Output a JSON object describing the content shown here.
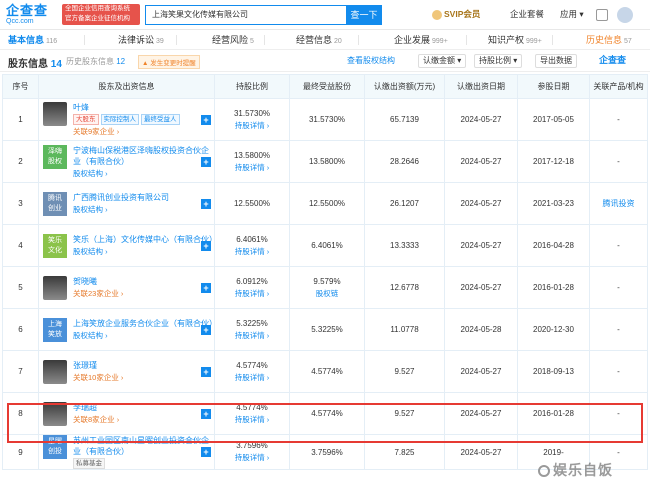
{
  "header": {
    "logo_main": "企查查",
    "logo_sub": "Qcc.com",
    "badge": "全国企业信用查询系统 官方备案企业征信机构",
    "search_value": "上海笑果文化传媒有限公司",
    "search_btn": "查一下",
    "svip": "SVIP会员",
    "enterprise": "企业套餐",
    "apps": "应用 ▾"
  },
  "tabs": [
    {
      "label": "基本信息",
      "count": "116"
    },
    {
      "label": "法律诉讼",
      "count": "39"
    },
    {
      "label": "经营风险",
      "count": "5"
    },
    {
      "label": "经营信息",
      "count": "20"
    },
    {
      "label": "企业发展",
      "count": "999+"
    },
    {
      "label": "知识产权",
      "count": "999+"
    },
    {
      "label": "历史信息",
      "count": "57"
    }
  ],
  "subbar": {
    "title": "股东信息",
    "count": "14",
    "history": "历史股东信息",
    "history_count": "12",
    "warn": "▲ 发生变更时提醒",
    "view_map": "查看股权结构",
    "btn_amount": "认缴金额 ▾",
    "btn_ratio": "持股比例 ▾",
    "btn_export": "导出数据",
    "brand": "企查查"
  },
  "columns": [
    "序号",
    "股东及出资信息",
    "持股比例",
    "最终受益股份",
    "认缴出资额(万元)",
    "认缴出资日期",
    "参股日期",
    "关联产品/机构"
  ],
  "rows": [
    {
      "no": "1",
      "name": "叶烽",
      "avatar": "photo",
      "tags": [
        [
          "大股东",
          "red"
        ],
        [
          "实际控制人",
          "blue"
        ],
        [
          "最终受益人",
          "blue"
        ]
      ],
      "link": "关联9家企业 ›",
      "link_color": "orange",
      "ratio": "31.5730%",
      "ratio_link": "持股详情 ›",
      "final": "31.5730%",
      "amount": "65.7139",
      "sub_date": "2024-05-27",
      "join_date": "2017-05-05",
      "product": "-"
    },
    {
      "no": "2",
      "name": "宁波梅山保税港区泽嗨股权投资合伙企业（有限合伙）",
      "avatar": "logo",
      "logo_text": "泽嗨股权",
      "logo_color": "#5cb85c",
      "tags": [],
      "link": "股权结构 ›",
      "link_color": "blue",
      "ratio": "13.5800%",
      "ratio_link": "持股详情 ›",
      "final": "13.5800%",
      "amount": "28.2646",
      "sub_date": "2024-05-27",
      "join_date": "2017-12-18",
      "product": "-"
    },
    {
      "no": "3",
      "name": "广西腾讯创业投资有限公司",
      "avatar": "logo",
      "logo_text": "腾讯创业",
      "logo_color": "#6f8fb4",
      "tags": [],
      "link": "股权结构 ›",
      "link_color": "blue",
      "ratio": "12.5500%",
      "ratio_link": "",
      "final": "12.5500%",
      "amount": "26.1207",
      "sub_date": "2024-05-27",
      "join_date": "2021-03-23",
      "product": "腾讯投资"
    },
    {
      "no": "4",
      "name": "笑乐（上海）文化传媒中心（有限合伙）",
      "avatar": "logo",
      "logo_text": "笑乐文化",
      "logo_color": "#8bc34a",
      "tags": [],
      "link": "股权结构 ›",
      "link_color": "blue",
      "ratio": "6.4061%",
      "ratio_link": "持股详情 ›",
      "final": "6.4061%",
      "amount": "13.3333",
      "sub_date": "2024-05-27",
      "join_date": "2016-04-28",
      "product": "-"
    },
    {
      "no": "5",
      "name": "贺晓曦",
      "avatar": "photo",
      "tags": [],
      "link": "关联23家企业 ›",
      "link_color": "orange",
      "ratio": "6.0912%",
      "ratio_link": "持股详情 ›",
      "final": "9.579%",
      "final_link": "股权链",
      "amount": "12.6778",
      "sub_date": "2024-05-27",
      "join_date": "2016-01-28",
      "product": "-"
    },
    {
      "no": "6",
      "name": "上海笑放企业服务合伙企业（有限合伙）",
      "avatar": "logo",
      "logo_text": "上海笑放",
      "logo_color": "#4a90d9",
      "tags": [],
      "link": "股权结构 ›",
      "link_color": "blue",
      "ratio": "5.3225%",
      "ratio_link": "持股详情 ›",
      "final": "5.3225%",
      "amount": "11.0778",
      "sub_date": "2024-05-28",
      "join_date": "2020-12-30",
      "product": "-"
    },
    {
      "no": "7",
      "name": "张璟瑾",
      "avatar": "photo",
      "tags": [],
      "link": "关联10家企业 ›",
      "link_color": "orange",
      "ratio": "4.5774%",
      "ratio_link": "持股详情 ›",
      "final": "4.5774%",
      "amount": "9.527",
      "sub_date": "2024-05-27",
      "join_date": "2018-09-13",
      "product": "-"
    },
    {
      "no": "8",
      "name": "李瑞超",
      "avatar": "photo",
      "tags": [],
      "link": "关联8家企业 ›",
      "link_color": "orange",
      "ratio": "4.5774%",
      "ratio_link": "持股详情 ›",
      "final": "4.5774%",
      "amount": "9.527",
      "sub_date": "2024-05-27",
      "join_date": "2016-01-28",
      "product": "-"
    },
    {
      "no": "9",
      "name": "苏州工业园区南山星曜创业投资合伙企业（有限合伙）",
      "avatar": "logo",
      "logo_text": "星曜创投",
      "logo_color": "#4a90d9",
      "tags": [
        [
          "私募基金",
          "gray"
        ]
      ],
      "link": "",
      "link_color": "blue",
      "ratio": "3.7596%",
      "ratio_link": "持股详情 ›",
      "final": "3.7596%",
      "amount": "7.825",
      "sub_date": "2024-05-27",
      "join_date": "2019-",
      "product": "-"
    }
  ],
  "watermark": "娱乐自饭"
}
